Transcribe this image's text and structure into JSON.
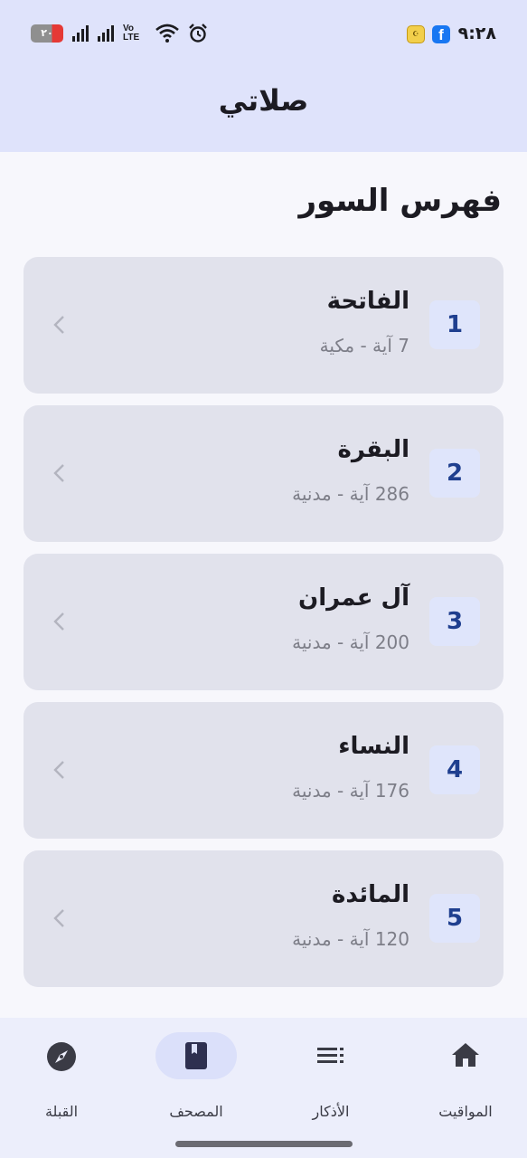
{
  "status_bar": {
    "time": "٩:٢٨",
    "battery": "٢٠",
    "network_label": "Vo LTE"
  },
  "app_bar": {
    "title": "صلاتي"
  },
  "section_title": "فهرس السور",
  "suras": [
    {
      "number": "1",
      "name": "الفاتحة",
      "info": "7 آية - مكية"
    },
    {
      "number": "2",
      "name": "البقرة",
      "info": "286 آية - مدنية"
    },
    {
      "number": "3",
      "name": "آل عمران",
      "info": "200 آية - مدنية"
    },
    {
      "number": "4",
      "name": "النساء",
      "info": "176 آية - مدنية"
    },
    {
      "number": "5",
      "name": "المائدة",
      "info": "120 آية - مدنية"
    }
  ],
  "bottom_nav": {
    "items": [
      {
        "label": "المواقيت",
        "icon": "home-icon"
      },
      {
        "label": "الأذكار",
        "icon": "list-icon"
      },
      {
        "label": "المصحف",
        "icon": "book-icon",
        "active": true
      },
      {
        "label": "القبلة",
        "icon": "compass-icon"
      }
    ]
  },
  "colors": {
    "app_bar_bg": "#dfe3fb",
    "card_bg": "#e1e2ec",
    "number_color": "#1f3f8f",
    "active_pill": "#dbe0fa"
  }
}
